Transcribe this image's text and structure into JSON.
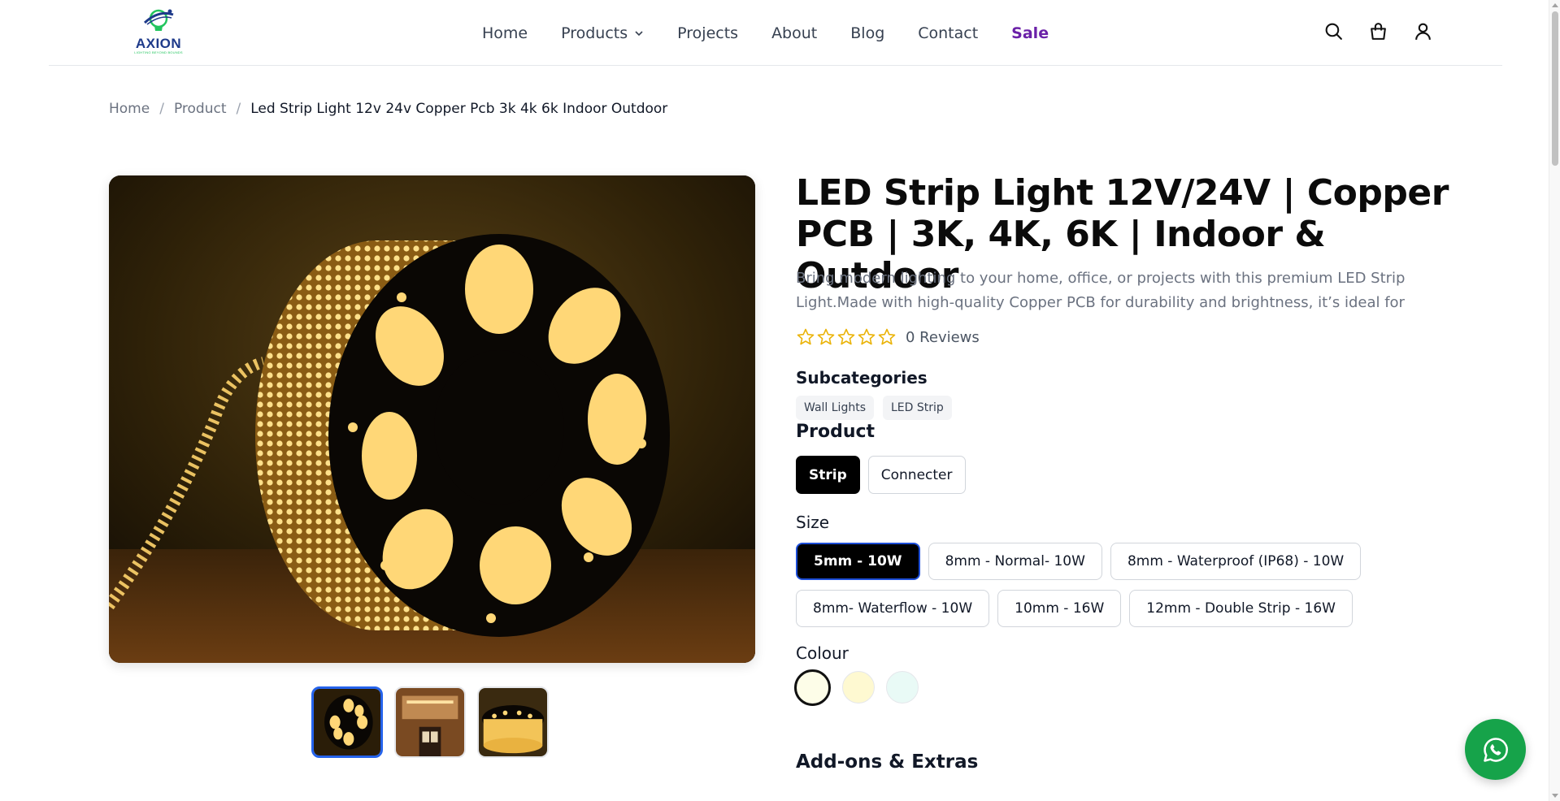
{
  "brand": {
    "name": "AXION",
    "tagline": "LIGHTING BEYOND BOUNDS",
    "colors": {
      "navy": "#1e3a8a",
      "green": "#22c55e"
    }
  },
  "nav": {
    "items": [
      {
        "label": "Home"
      },
      {
        "label": "Products",
        "has_dropdown": true
      },
      {
        "label": "Projects"
      },
      {
        "label": "About"
      },
      {
        "label": "Blog"
      },
      {
        "label": "Contact"
      },
      {
        "label": "Sale",
        "accent": "#6b21a8"
      }
    ],
    "icons": [
      "search-icon",
      "shopping-bag-icon",
      "user-icon"
    ]
  },
  "breadcrumb": {
    "home": "Home",
    "separator": "/",
    "product": "Product",
    "current": "Led Strip Light 12v 24v Copper Pcb 3k 4k 6k Indoor Outdoor"
  },
  "gallery": {
    "thumbnails": [
      "led-reel",
      "ceiling-cove",
      "led-reel-closeup"
    ],
    "active_index": 0,
    "active_border": "#2563eb"
  },
  "product": {
    "title": "LED Strip Light 12V/24V | Copper PCB | 3K, 4K, 6K | Indoor & Outdoor",
    "description": "Bring modern lighting to your home, office, or projects with this premium LED Strip Light.Made with high-quality Copper PCB for durability and brightness, it’s ideal for both...",
    "rating": {
      "stars": 0,
      "max": 5,
      "reviews_label": "0 Reviews",
      "star_color": "#eab308"
    },
    "subcategories": {
      "label": "Subcategories",
      "items": [
        "Wall Lights",
        "LED Strip"
      ]
    },
    "product_type": {
      "label": "Product",
      "options": [
        "Strip",
        "Connecter"
      ],
      "selected": "Strip"
    },
    "size": {
      "label": "Size",
      "row1": [
        "5mm - 10W",
        "8mm - Normal- 10W",
        "8mm - Waterproof (IP68) - 10W"
      ],
      "row2": [
        "8mm- Waterflow - 10W",
        "10mm - 16W",
        "12mm - Double Strip - 16W"
      ],
      "selected": "5mm - 10W"
    },
    "colour": {
      "label": "Colour",
      "swatches": [
        "#fdfde8",
        "#fef9d1",
        "#e9faf6"
      ],
      "selected_index": 0
    },
    "addons_heading": "Add-ons & Extras"
  },
  "whatsapp": {
    "icon": "whatsapp-icon",
    "color": "#16a34a"
  }
}
